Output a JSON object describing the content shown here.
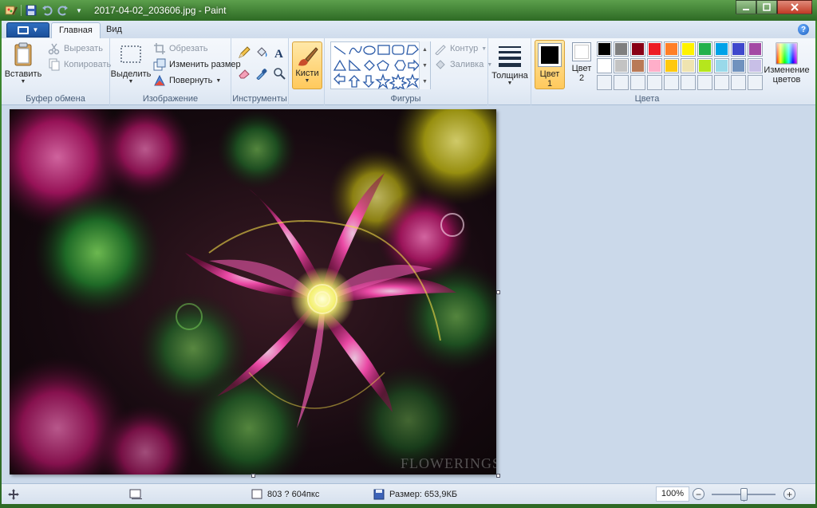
{
  "window": {
    "title": "2017-04-02_203606.jpg - Paint"
  },
  "tabs": {
    "home": "Главная",
    "view": "Вид"
  },
  "clipboard": {
    "paste": "Вставить",
    "cut": "Вырезать",
    "copy": "Копировать",
    "group": "Буфер обмена"
  },
  "image": {
    "select": "Выделить",
    "crop": "Обрезать",
    "resize": "Изменить размер",
    "rotate": "Повернуть",
    "group": "Изображение"
  },
  "tools": {
    "group": "Инструменты"
  },
  "brushes": {
    "label": "Кисти"
  },
  "shapes": {
    "outline": "Контур",
    "fill": "Заливка",
    "group": "Фигуры"
  },
  "size": {
    "label": "Толщина"
  },
  "colors": {
    "color1_l1": "Цвет",
    "color1_l2": "1",
    "color2_l1": "Цвет",
    "color2_l2": "2",
    "edit_l1": "Изменение",
    "edit_l2": "цветов",
    "group": "Цвета",
    "color1": "#000000",
    "color2": "#ffffff",
    "palette": [
      "#000000",
      "#7f7f7f",
      "#880015",
      "#ed1c24",
      "#ff7f27",
      "#fff200",
      "#22b14c",
      "#00a2e8",
      "#3f48cc",
      "#a349a4",
      "#ffffff",
      "#c3c3c3",
      "#b97a57",
      "#ffaec9",
      "#ffc90e",
      "#efe4b0",
      "#b5e61d",
      "#99d9ea",
      "#7092be",
      "#c8bfe7"
    ]
  },
  "canvas": {
    "watermark": "FLOWERINGS"
  },
  "status": {
    "dimensions": "803 ? 604пкс",
    "size": "Размер: 653,9КБ",
    "zoom": "100%"
  }
}
